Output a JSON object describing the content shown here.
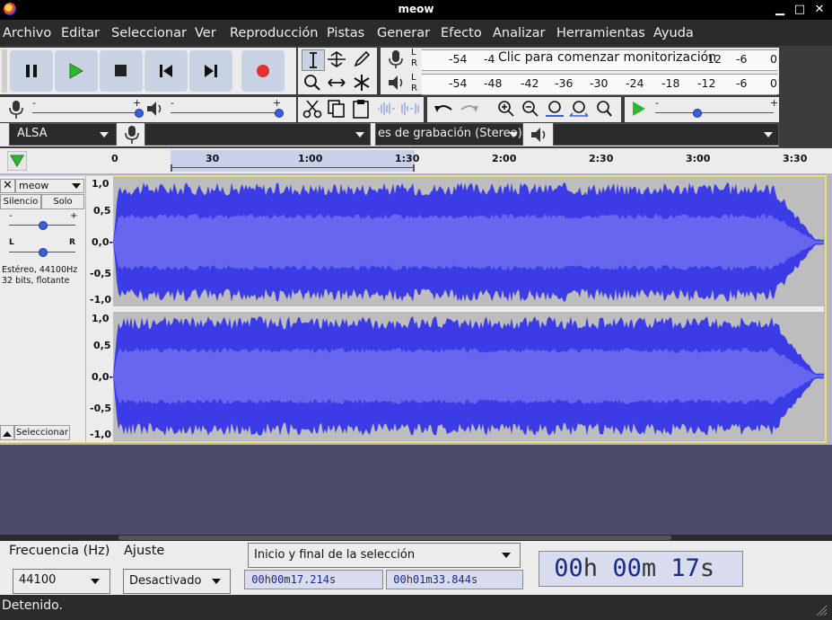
{
  "window": {
    "title": "meow",
    "minimize": "▁",
    "maximize": "□",
    "close": "✕"
  },
  "menu": [
    "Archivo",
    "Editar",
    "Seleccionar",
    "Ver",
    "Reproducción",
    "Pistas",
    "Generar",
    "Efecto",
    "Analizar",
    "Herramientas",
    "Ayuda"
  ],
  "meters": {
    "rec_labels": [
      "-54",
      "-4",
      "Clic para comenzar monitorización",
      "12",
      "-6",
      "0"
    ],
    "play_labels": [
      "-54",
      "-48",
      "-42",
      "-36",
      "-30",
      "-24",
      "-18",
      "-12",
      "-6",
      "0"
    ],
    "L": "L",
    "R": "R"
  },
  "sliders": {
    "minus": "-",
    "plus": "+",
    "rec_volume": 1.0,
    "play_volume": 1.0,
    "play_speed": 0.35
  },
  "device": {
    "host": "ALSA",
    "input_device": "",
    "channels": "es de grabación (Stereo)",
    "output_device": ""
  },
  "timeline": {
    "ticks": [
      "0",
      "30",
      "1:00",
      "1:30",
      "2:00",
      "2:30",
      "3:00",
      "3:30"
    ]
  },
  "track": {
    "name": "meow",
    "mute": "Silencio",
    "solo": "Solo",
    "gain_minus": "-",
    "gain_plus": "+",
    "pan_left": "L",
    "pan_right": "R",
    "info_line1": "Estéreo, 44100Hz",
    "info_line2": "32 bits, flotante",
    "select_label": "Seleccionar",
    "scale": [
      "1,0",
      "0,5",
      "0,0-",
      "-0,5",
      "-1,0"
    ]
  },
  "bottom": {
    "rate_label": "Frecuencia (Hz)",
    "rate_value": "44100",
    "snap_label": "Ajuste",
    "snap_value": "Desactivado",
    "selection_mode": "Inicio y final de la selección",
    "sel_start": {
      "h": "00",
      "m": "00",
      "s": "17.214"
    },
    "sel_end": {
      "h": "00",
      "m": "01",
      "s": "33.844"
    },
    "unit_h": "h",
    "unit_m": "m",
    "unit_s": "s",
    "audio_position": {
      "h": "00",
      "m": "00",
      "s": "17"
    }
  },
  "status": {
    "text": "Detenido."
  },
  "colors": {
    "waveform": "#3c3ce6",
    "waveform_rms": "#6666ee",
    "wave_bg": "#bdbdbd",
    "record": "#e03030",
    "play": "#2fb82f"
  }
}
